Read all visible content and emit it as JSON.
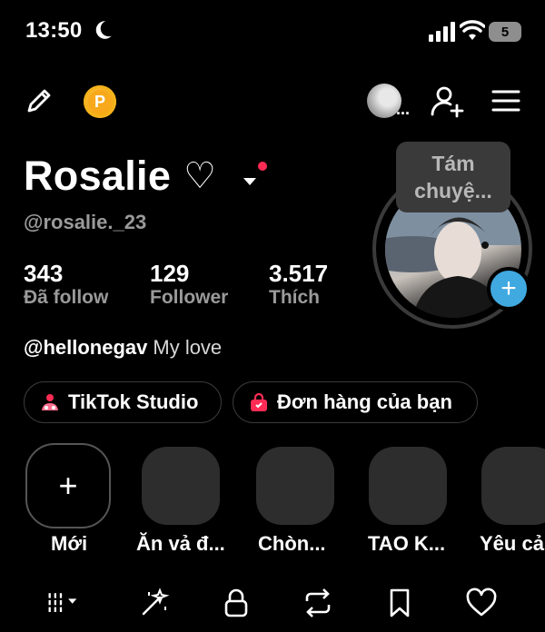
{
  "status_bar": {
    "time": "13:50",
    "battery": "5"
  },
  "profile": {
    "name": "Rosalie",
    "name_symbol": "♡",
    "username": "@rosalie._23",
    "bubble_line1": "Tám",
    "bubble_line2": "chuyệ...",
    "stats": [
      {
        "value": "343",
        "label": "Đã follow"
      },
      {
        "value": "129",
        "label": "Follower"
      },
      {
        "value": "3.517",
        "label": "Thích"
      }
    ],
    "bio_mention": "@hellonegav",
    "bio_text": "My love"
  },
  "buttons": {
    "studio": "TikTok Studio",
    "orders": "Đơn hàng của bạn"
  },
  "highlights": [
    {
      "label": "Mới"
    },
    {
      "label": "Ăn vả đ..."
    },
    {
      "label": "Chòn..."
    },
    {
      "label": "TAO K..."
    },
    {
      "label": "Yêu cả"
    }
  ],
  "colors": {
    "accent": "#fe2c55",
    "plus_blue": "#3fa9e0",
    "coin": "#f5a91b"
  },
  "icons": [
    "moon-icon",
    "signal-icon",
    "wifi-icon",
    "pencil-icon",
    "coin-icon",
    "add-user-icon",
    "menu-icon",
    "grid-icon",
    "sparkle-icon",
    "lock-icon",
    "repost-icon",
    "bookmark-icon",
    "heart-icon"
  ]
}
